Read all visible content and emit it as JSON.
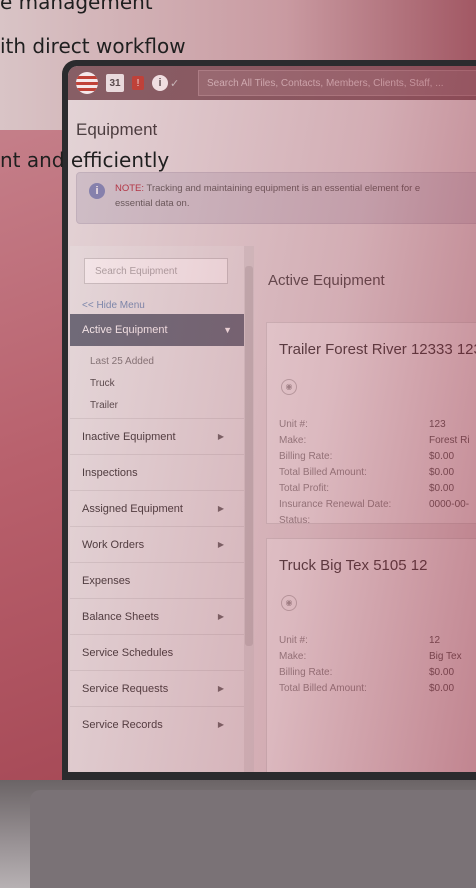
{
  "marketing": {
    "line1": "e management",
    "line2": "ith direct workflow",
    "line3": "nt and efficiently"
  },
  "topbar": {
    "calendar_day": "31",
    "alert_glyph": "!",
    "info_glyph": "i",
    "search_placeholder": "Search All Tiles, Contacts, Members, Clients, Staff, ..."
  },
  "page": {
    "title": "Equipment",
    "note_label": "NOTE:",
    "note_text_1": " Tracking and maintaining equipment is an essential element for e",
    "note_text_2": "essential data on."
  },
  "sidebar": {
    "search_placeholder": "Search Equipment",
    "hide_menu": "<< Hide Menu",
    "active": "Active Equipment",
    "subitems": [
      "Last 25 Added",
      "Truck",
      "Trailer"
    ],
    "items": [
      {
        "label": "Inactive Equipment",
        "has_arrow": true
      },
      {
        "label": "Inspections",
        "has_arrow": false
      },
      {
        "label": "Assigned Equipment",
        "has_arrow": true
      },
      {
        "label": "Work Orders",
        "has_arrow": true
      },
      {
        "label": "Expenses",
        "has_arrow": false
      },
      {
        "label": "Balance Sheets",
        "has_arrow": true
      },
      {
        "label": "Service Schedules",
        "has_arrow": false
      },
      {
        "label": "Service Requests",
        "has_arrow": true
      },
      {
        "label": "Service Records",
        "has_arrow": true
      }
    ]
  },
  "main": {
    "title": "Active Equipment",
    "cards": [
      {
        "title": "Trailer Forest River 12333 123",
        "rows": [
          {
            "label": "Unit #:",
            "value": "123"
          },
          {
            "label": "Make:",
            "value": "Forest Ri"
          },
          {
            "label": "Billing Rate:",
            "value": "$0.00"
          },
          {
            "label": "Total Billed Amount:",
            "value": "$0.00"
          },
          {
            "label": "Total Profit:",
            "value": "$0.00"
          },
          {
            "label": "Insurance Renewal Date:",
            "value": "0000-00-"
          },
          {
            "label": "Status:",
            "value": ""
          }
        ]
      },
      {
        "title": "Truck Big Tex 5105 12",
        "rows": [
          {
            "label": "Unit #:",
            "value": "12"
          },
          {
            "label": "Make:",
            "value": "Big Tex"
          },
          {
            "label": "Billing Rate:",
            "value": "$0.00"
          },
          {
            "label": "Total Billed Amount:",
            "value": "$0.00"
          }
        ]
      }
    ]
  }
}
